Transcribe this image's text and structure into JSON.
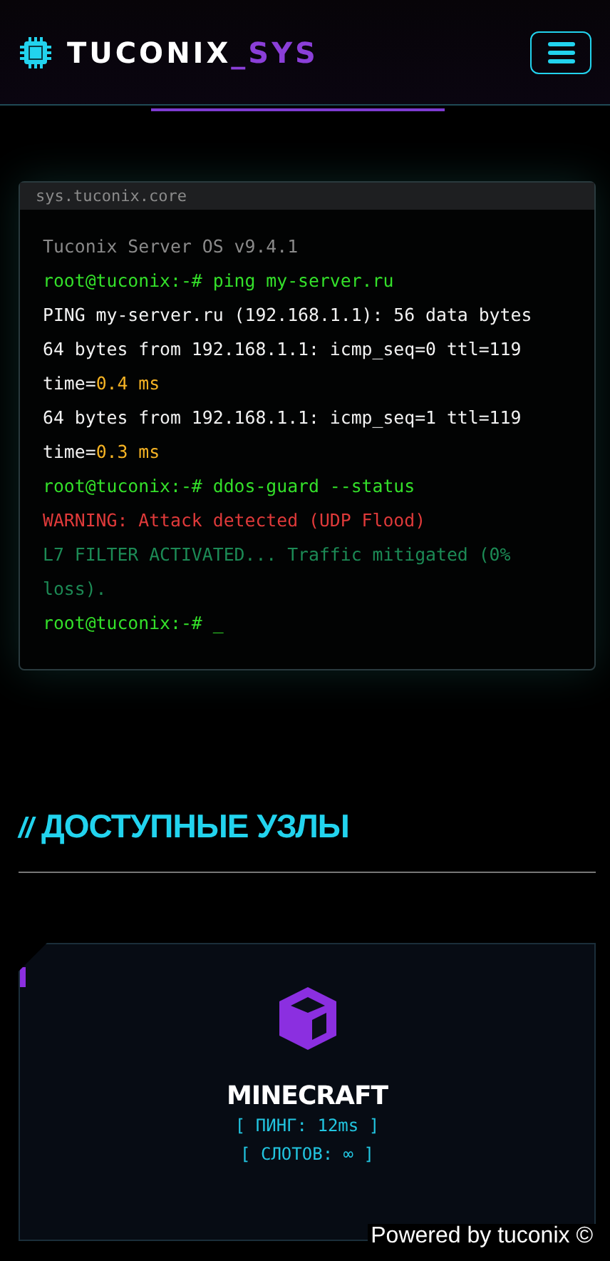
{
  "header": {
    "logo_main": "TUCONIX",
    "logo_accent": "_SYS"
  },
  "terminal": {
    "title": "sys.tuconix.core",
    "lines": [
      {
        "kind": "muted",
        "text": "Tuconix Server OS v9.4.1"
      },
      {
        "kind": "prompt",
        "prompt": "root@tuconix:-#",
        "text": "ping my-server.ru"
      },
      {
        "kind": "output",
        "text": "PING my-server.ru (192.168.1.1): 56 data bytes"
      },
      {
        "kind": "reply",
        "text": "64 bytes from 192.168.1.1: icmp_seq=0 ttl=119 time=",
        "value": "0.4 ms"
      },
      {
        "kind": "reply",
        "text": "64 bytes from 192.168.1.1: icmp_seq=1 ttl=119 time=",
        "value": "0.3 ms"
      },
      {
        "kind": "prompt",
        "prompt": "root@tuconix:-#",
        "text": "ddos-guard --status"
      },
      {
        "kind": "warning",
        "text": "WARNING: Attack detected (UDP Flood)"
      },
      {
        "kind": "success",
        "text": "L7 FILTER ACTIVATED... Traffic mitigated (0% loss)."
      },
      {
        "kind": "prompt",
        "prompt": "root@tuconix:-#",
        "text": "_"
      }
    ]
  },
  "section": {
    "slashes": "//",
    "title": "ДОСТУПНЫЕ УЗЛЫ"
  },
  "nodes": [
    {
      "name": "MINECRAFT",
      "stats": [
        "[ ПИНГ: 12ms ]",
        "[ СЛОТОВ: ∞ ]"
      ]
    }
  ],
  "footer_badge": "Powered by tuconix ©"
}
